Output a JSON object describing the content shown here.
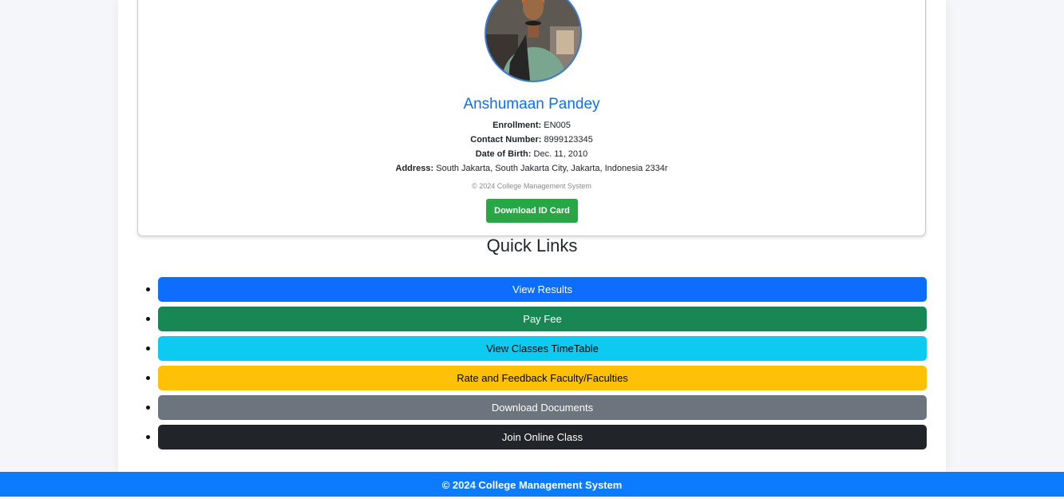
{
  "profile": {
    "name": "Anshumaan Pandey",
    "enrollment_label": "Enrollment:",
    "enrollment_value": "EN005",
    "contact_label": "Contact Number:",
    "contact_value": "8999123345",
    "dob_label": "Date of Birth:",
    "dob_value": "Dec. 11, 2010",
    "address_label": "Address:",
    "address_value": "South Jakarta, South Jakarta City, Jakarta, Indonesia 2334r",
    "card_footer": "© 2024 College Management System",
    "download_label": "Download ID Card",
    "download_color": "#28a745"
  },
  "quick_links": {
    "title": "Quick Links",
    "items": [
      {
        "label": "View Results",
        "bg": "#0d6efd",
        "fg": "#ffffff"
      },
      {
        "label": "Pay Fee",
        "bg": "#198754",
        "fg": "#ffffff"
      },
      {
        "label": "View Classes TimeTable",
        "bg": "#0dcaf0",
        "fg": "#000000"
      },
      {
        "label": "Rate and Feedback Faculty/Faculties",
        "bg": "#ffc107",
        "fg": "#000000"
      },
      {
        "label": "Download Documents",
        "bg": "#6c757d",
        "fg": "#ffffff"
      },
      {
        "label": "Join Online Class",
        "bg": "#212529",
        "fg": "#ffffff"
      }
    ]
  },
  "footer": {
    "text": "© 2024 College Management System",
    "bg": "#0d7bfd"
  }
}
